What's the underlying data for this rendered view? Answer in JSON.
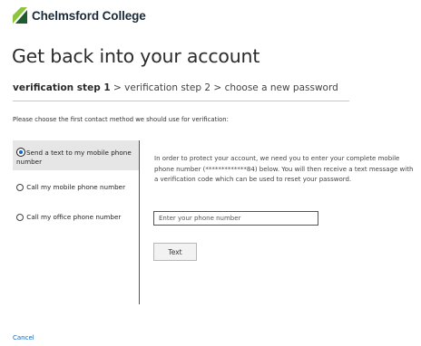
{
  "brand": {
    "name": "Chelmsford College",
    "colors": {
      "dark_green": "#1e5b2e",
      "light_green": "#8cc63f",
      "text": "#1b2a39"
    }
  },
  "page": {
    "title": "Get back into your account"
  },
  "steps": {
    "step1": "verification step 1",
    "sep1": " > ",
    "step2": "verification step 2",
    "sep2": " > ",
    "step3": "choose a new password"
  },
  "instruction": "Please choose the first contact method we should use for verification:",
  "options": [
    {
      "label_line1": "Send a text to my mobile phone",
      "label_line2": "number",
      "selected": true
    },
    {
      "label": "Call my mobile phone number",
      "selected": false
    },
    {
      "label": "Call my office phone number",
      "selected": false
    }
  ],
  "description": "In order to protect your account, we need you to enter your complete mobile phone number (*************84) below. You will then receive a text message with a verification code which can be used to reset your password.",
  "phone_input": {
    "value": "",
    "placeholder": "Enter your phone number"
  },
  "text_button": "Text",
  "cancel_link": "Cancel",
  "accent_color": "#1464c8"
}
